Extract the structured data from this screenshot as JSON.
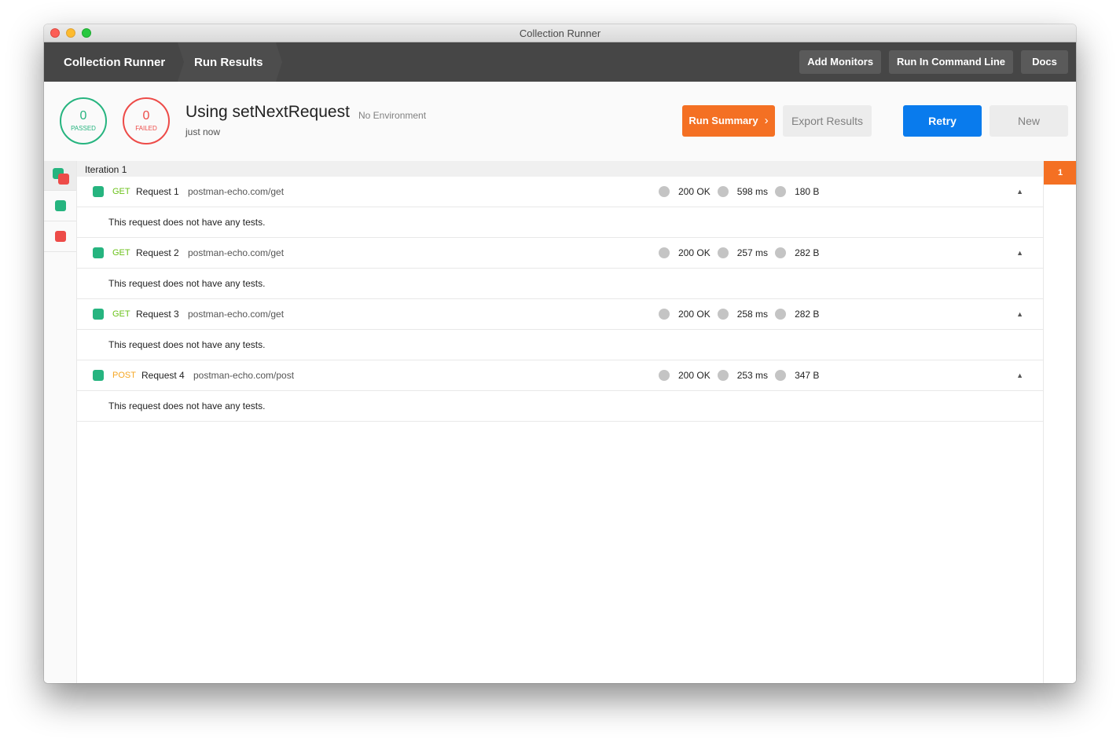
{
  "window": {
    "title": "Collection Runner"
  },
  "nav": {
    "breadcrumbs": [
      {
        "label": "Collection Runner"
      },
      {
        "label": "Run Results"
      }
    ],
    "actions": {
      "add_monitors": "Add Monitors",
      "run_cli": "Run In Command Line",
      "docs": "Docs"
    }
  },
  "summary": {
    "passed": {
      "count": "0",
      "label": "PASSED",
      "color": "#26b47f"
    },
    "failed": {
      "count": "0",
      "label": "FAILED",
      "color": "#ed4b48"
    },
    "title": "Using setNextRequest",
    "environment": "No Environment",
    "time": "just now",
    "buttons": {
      "run_summary": "Run Summary",
      "run_summary_chevron": "›",
      "export": "Export Results",
      "retry": "Retry",
      "new": "New"
    }
  },
  "iteration": {
    "label": "Iteration 1",
    "badge": "1"
  },
  "requests": [
    {
      "method": "GET",
      "name": "Request 1",
      "url": "postman-echo.com/get",
      "status": "200 OK",
      "time": "598 ms",
      "size": "180 B",
      "tests_msg": "This request does not have any tests."
    },
    {
      "method": "GET",
      "name": "Request 2",
      "url": "postman-echo.com/get",
      "status": "200 OK",
      "time": "257 ms",
      "size": "282 B",
      "tests_msg": "This request does not have any tests."
    },
    {
      "method": "GET",
      "name": "Request 3",
      "url": "postman-echo.com/get",
      "status": "200 OK",
      "time": "258 ms",
      "size": "282 B",
      "tests_msg": "This request does not have any tests."
    },
    {
      "method": "POST",
      "name": "Request 4",
      "url": "postman-echo.com/post",
      "status": "200 OK",
      "time": "253 ms",
      "size": "347 B",
      "tests_msg": "This request does not have any tests."
    }
  ],
  "colors": {
    "accent_orange": "#f47023",
    "primary_blue": "#097bed",
    "pass_green": "#26b47f",
    "fail_red": "#ed4b48",
    "get_green": "#6bc21b",
    "post_orange": "#f5a623"
  }
}
